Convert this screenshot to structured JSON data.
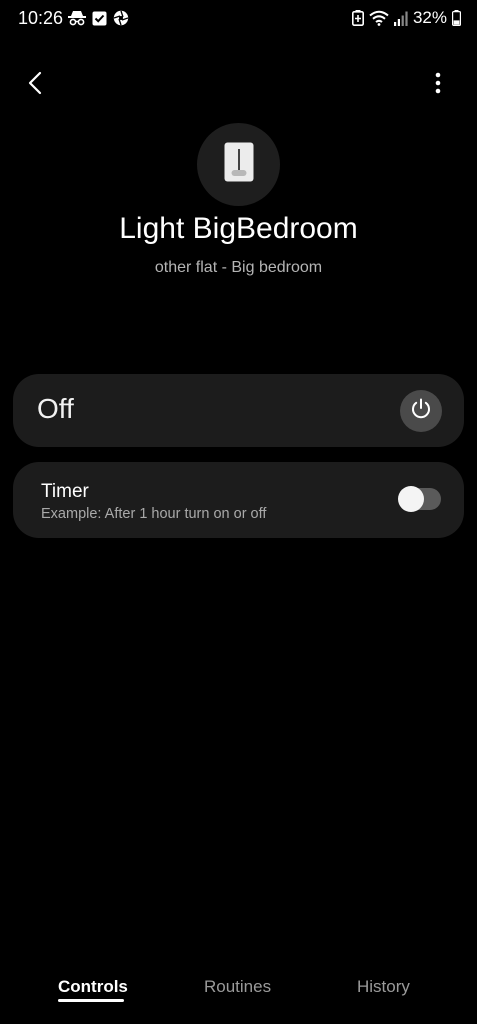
{
  "status_bar": {
    "time": "10:26",
    "left_icons": [
      "incognito-icon",
      "checkbox-icon",
      "aperture-icon"
    ],
    "right_icons": [
      "battery-saver-icon",
      "wifi-icon",
      "signal-icon"
    ],
    "battery_percent": "32%"
  },
  "nav": {
    "back_icon": "chevron-left-icon",
    "more_icon": "more-vertical-icon"
  },
  "device": {
    "icon": "light-switch-icon",
    "name": "Light BigBedroom",
    "location": "other flat - Big bedroom"
  },
  "power": {
    "state": "Off",
    "button_icon": "power-icon"
  },
  "timer": {
    "title": "Timer",
    "description": "Example: After 1 hour turn on or off",
    "enabled": false
  },
  "tabs": [
    {
      "label": "Controls",
      "active": true
    },
    {
      "label": "Routines",
      "active": false
    },
    {
      "label": "History",
      "active": false
    }
  ],
  "colors": {
    "background": "#000000",
    "card": "#1c1c1c",
    "power_button": "#4a4a4a",
    "toggle_track": "#5a5a5a",
    "subtitle": "#b4b4b4"
  }
}
